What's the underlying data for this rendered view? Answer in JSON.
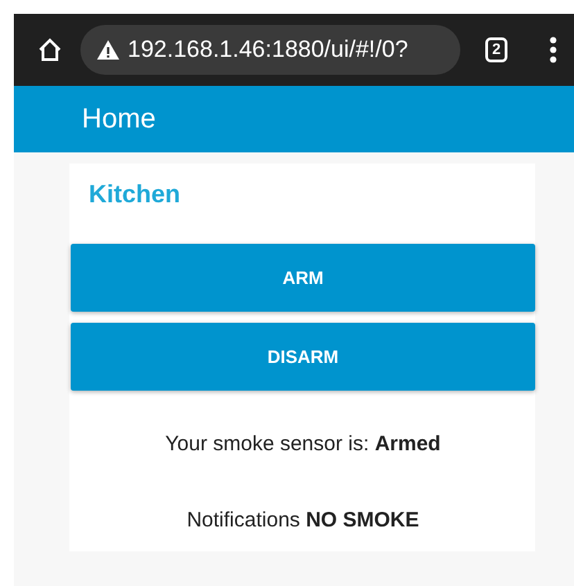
{
  "browser": {
    "url": "192.168.1.46:1880/ui/#!/0?",
    "tab_count": "2"
  },
  "header": {
    "title": "Home"
  },
  "card": {
    "title": "Kitchen",
    "buttons": [
      "ARM",
      "DISARM"
    ],
    "texts": [
      {
        "text": "Your smoke sensor is: **Armed**"
      },
      {
        "text": "Notifications **NO SMOKE**"
      }
    ]
  }
}
